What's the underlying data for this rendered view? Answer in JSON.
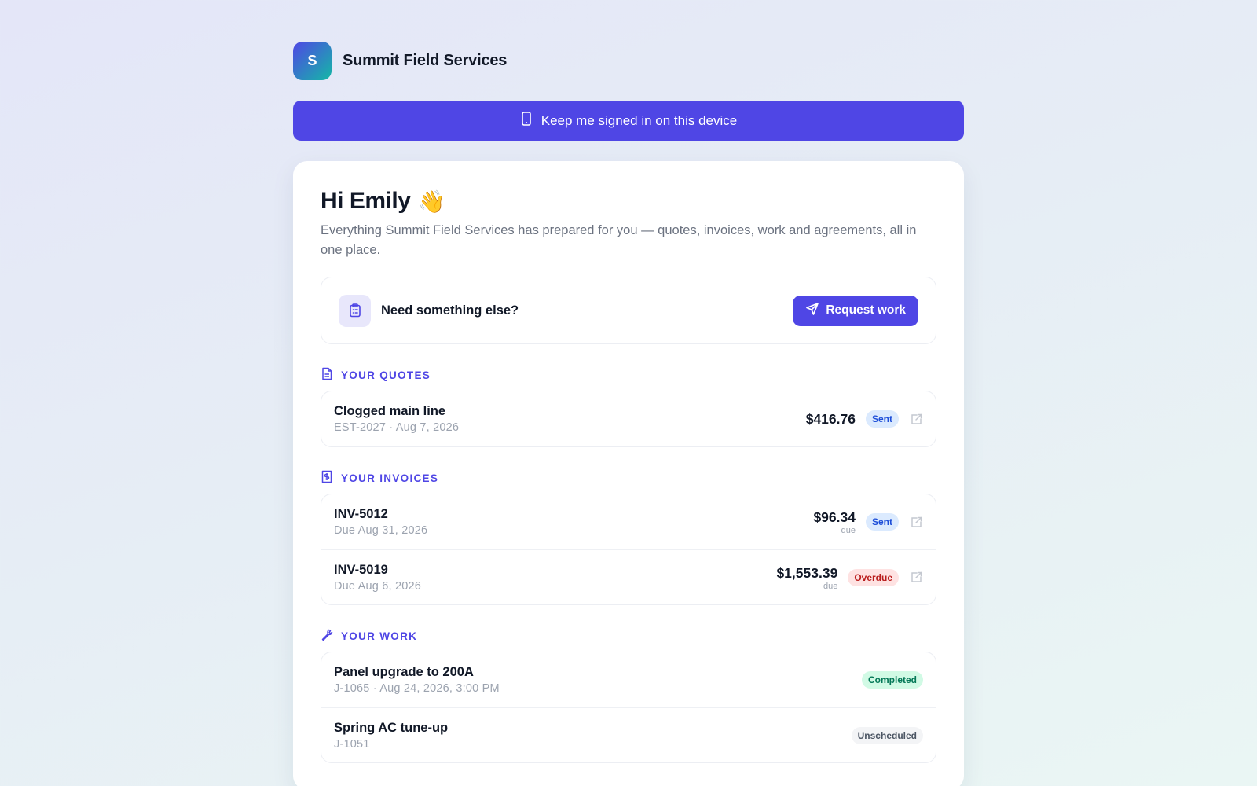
{
  "brand": {
    "initial": "S",
    "name": "Summit Field Services"
  },
  "keep_signed_in": {
    "label": "Keep me signed in on this device",
    "icon": "phone-icon"
  },
  "greeting": {
    "title": "Hi Emily",
    "emoji": "👋",
    "intro": "Everything Summit Field Services has prepared for you — quotes, invoices, work and agreements, all in one place."
  },
  "request": {
    "title": "Need something else?",
    "button_label": "Request work",
    "icon": "clipboard-icon"
  },
  "quotes": {
    "heading": "YOUR QUOTES",
    "items": [
      {
        "title": "Clogged main line",
        "subtitle": "EST-2027 · Aug 7, 2026",
        "amount": "$416.76",
        "status": "Sent"
      }
    ]
  },
  "invoices": {
    "heading": "YOUR INVOICES",
    "items": [
      {
        "title": "INV-5012",
        "subtitle": "Due Aug 31, 2026",
        "amount": "$96.34",
        "due_label": "due",
        "status": "Sent"
      },
      {
        "title": "INV-5019",
        "subtitle": "Due Aug 6, 2026",
        "amount": "$1,553.39",
        "due_label": "due",
        "status": "Overdue"
      }
    ]
  },
  "work": {
    "heading": "YOUR WORK",
    "items": [
      {
        "title": "Panel upgrade to 200A",
        "subtitle": "J-1065 · Aug 24, 2026, 3:00 PM",
        "status": "Completed"
      },
      {
        "title": "Spring AC tune-up",
        "subtitle": "J-1051",
        "status": "Unscheduled"
      }
    ]
  },
  "colors": {
    "accent": "#4f46e5",
    "sent": "#1d4ed8",
    "overdue": "#b91c1c",
    "completed": "#047857"
  }
}
